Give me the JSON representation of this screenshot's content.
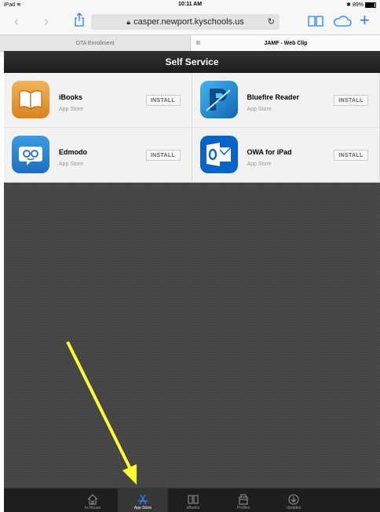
{
  "status_bar": {
    "device": "iPad",
    "time": "10:11 AM",
    "battery": "89%"
  },
  "browser": {
    "url": "casper.newport.kyschools.us",
    "tabs": [
      {
        "label": "OTA Enrollment",
        "active": false
      },
      {
        "label": "JAMF - Web Clip",
        "active": true
      }
    ]
  },
  "header": {
    "title": "Self Service"
  },
  "apps": [
    {
      "name": "iBooks",
      "source": "App Store",
      "button": "INSTALL",
      "icon": "ibooks-icon"
    },
    {
      "name": "Bluefire Reader",
      "source": "App Store",
      "button": "INSTALL",
      "icon": "bluefire-reader-icon"
    },
    {
      "name": "Edmodo",
      "source": "App Store",
      "button": "INSTALL",
      "icon": "edmodo-icon"
    },
    {
      "name": "OWA for iPad",
      "source": "App Store",
      "button": "INSTALL",
      "icon": "owa-icon"
    }
  ],
  "tabbar": {
    "items": [
      {
        "label": "In-House",
        "icon": "house-icon"
      },
      {
        "label": "App Store",
        "icon": "app-store-icon",
        "active": true
      },
      {
        "label": "eBooks",
        "icon": "books-icon"
      },
      {
        "label": "Profiles",
        "icon": "profiles-icon"
      },
      {
        "label": "Updates",
        "icon": "updates-icon"
      }
    ]
  },
  "colors": {
    "accent": "#2b7cf6",
    "header_bg": "#222222",
    "content_bg": "#454545",
    "arrow": "#ffff33"
  }
}
